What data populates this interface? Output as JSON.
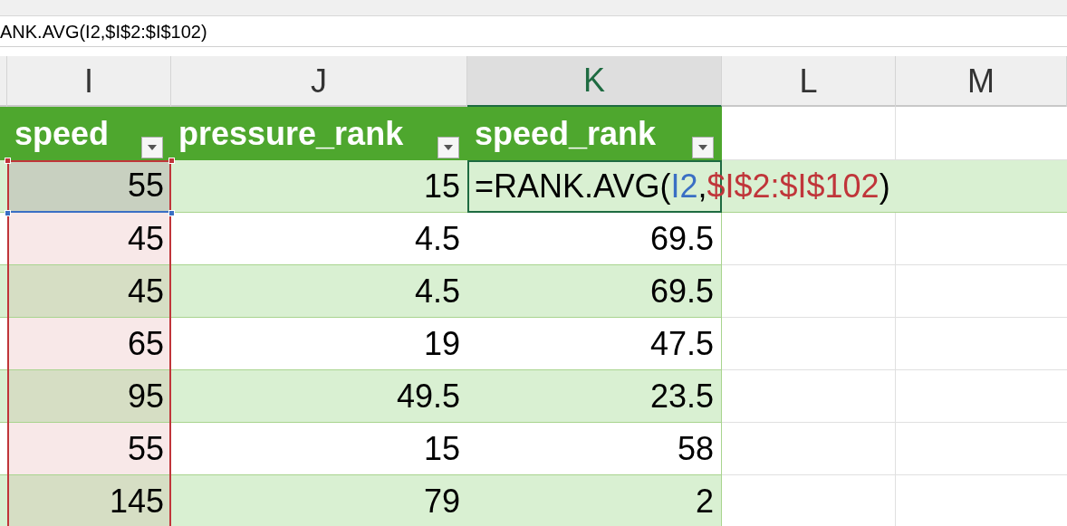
{
  "formula_bar": {
    "value": "ANK.AVG(I2,$I$2:$I$102)"
  },
  "columns": [
    {
      "label": "I",
      "selected": false
    },
    {
      "label": "J",
      "selected": false
    },
    {
      "label": "K",
      "selected": true
    },
    {
      "label": "L",
      "selected": false
    },
    {
      "label": "M",
      "selected": false
    }
  ],
  "table": {
    "headers": [
      "speed",
      "pressure_rank",
      "speed_rank"
    ],
    "editing_formula": [
      {
        "text": "=RANK.AVG(",
        "color": "#000000"
      },
      {
        "text": "I2",
        "color": "#3a6fc4"
      },
      {
        "text": ",",
        "color": "#000000"
      },
      {
        "text": "$I$2:$I$102",
        "color": "#c0353a"
      },
      {
        "text": ")",
        "color": "#000000"
      }
    ],
    "rows": [
      {
        "speed": "55",
        "pressure_rank": "15"
      },
      {
        "speed": "45",
        "pressure_rank": "4.5",
        "speed_rank": "69.5"
      },
      {
        "speed": "45",
        "pressure_rank": "4.5",
        "speed_rank": "69.5"
      },
      {
        "speed": "65",
        "pressure_rank": "19",
        "speed_rank": "47.5"
      },
      {
        "speed": "95",
        "pressure_rank": "49.5",
        "speed_rank": "23.5"
      },
      {
        "speed": "55",
        "pressure_rank": "15",
        "speed_rank": "58"
      },
      {
        "speed": "145",
        "pressure_rank": "79",
        "speed_rank": "2"
      }
    ]
  }
}
